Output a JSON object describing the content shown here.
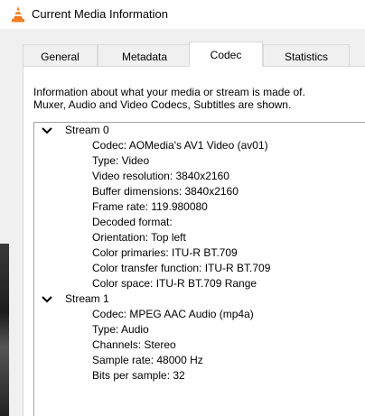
{
  "window": {
    "title": "Current Media Information"
  },
  "tabs": [
    {
      "label": "General",
      "active": false
    },
    {
      "label": "Metadata",
      "active": false
    },
    {
      "label": "Codec",
      "active": true
    },
    {
      "label": "Statistics",
      "active": false
    }
  ],
  "description": {
    "line1": "Information about what your media or stream is made of.",
    "line2": "Muxer, Audio and Video Codecs, Subtitles are shown."
  },
  "streams": [
    {
      "label": "Stream 0",
      "properties": [
        "Codec: AOMedia's AV1 Video (av01)",
        "Type: Video",
        "Video resolution: 3840x2160",
        "Buffer dimensions: 3840x2160",
        "Frame rate: 119.980080",
        "Decoded format:",
        "Orientation: Top left",
        "Color primaries: ITU-R BT.709",
        "Color transfer function: ITU-R BT.709",
        "Color space: ITU-R BT.709 Range"
      ]
    },
    {
      "label": "Stream 1",
      "properties": [
        "Codec: MPEG AAC Audio (mp4a)",
        "Type: Audio",
        "Channels: Stereo",
        "Sample rate: 48000 Hz",
        "Bits per sample: 32"
      ]
    }
  ],
  "colors": {
    "vlc_orange": "#f47b20",
    "tab_border": "#d9d9d9",
    "dialog_bg": "#f0f0f0"
  }
}
